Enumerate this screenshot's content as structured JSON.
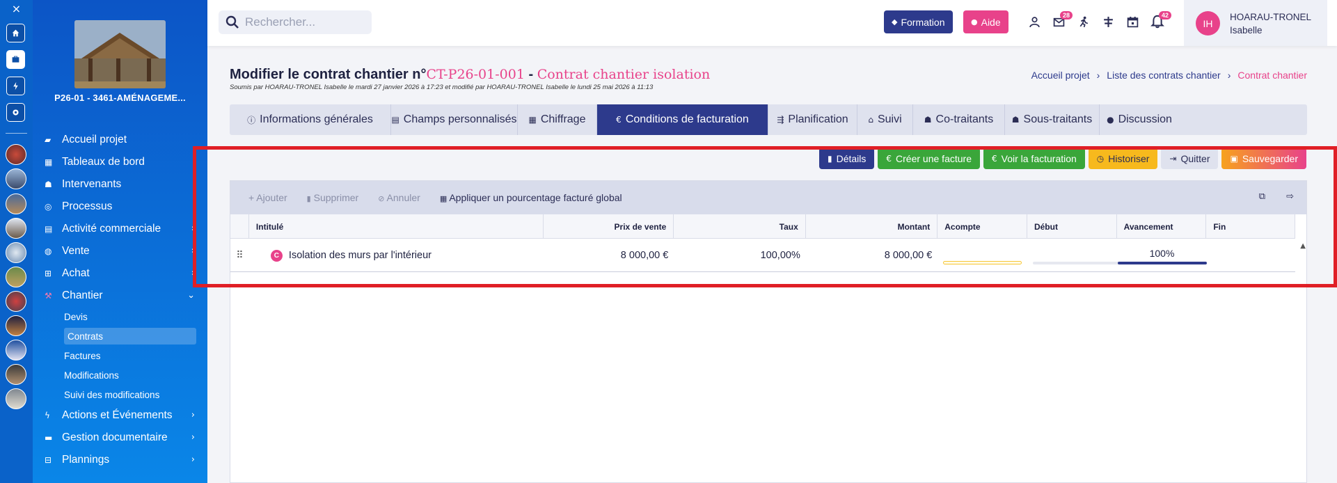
{
  "rail": {
    "close": "×"
  },
  "sidebar": {
    "project_title": "P26-01 - 3461-AMÉNAGEME...",
    "items": [
      {
        "label": "Accueil projet",
        "icon": "briefcase-icon",
        "chevron": false
      },
      {
        "label": "Tableaux de bord",
        "icon": "dashboard-icon",
        "chevron": false
      },
      {
        "label": "Intervenants",
        "icon": "people-icon",
        "chevron": false
      },
      {
        "label": "Processus",
        "icon": "process-icon",
        "chevron": false
      },
      {
        "label": "Activité commerciale",
        "icon": "document-icon",
        "chevron": true
      },
      {
        "label": "Vente",
        "icon": "sale-icon",
        "chevron": true
      },
      {
        "label": "Achat",
        "icon": "cart-icon",
        "chevron": true
      },
      {
        "label": "Chantier",
        "icon": "crane-icon",
        "chevron": true,
        "expanded": true
      }
    ],
    "subitems": [
      "Devis",
      "Contrats",
      "Factures",
      "Modifications",
      "Suivi des modifications"
    ],
    "items_after": [
      {
        "label": "Actions et Événements",
        "icon": "bolt-icon"
      },
      {
        "label": "Gestion documentaire",
        "icon": "folder-icon"
      },
      {
        "label": "Plannings",
        "icon": "calendar-icon"
      }
    ]
  },
  "topbar": {
    "search_placeholder": "Rechercher...",
    "formation": "Formation",
    "aide": "Aide",
    "mail_badge": "28",
    "bell_badge": "42",
    "user_initials": "IH",
    "user_line1": "HOARAU-TRONEL",
    "user_line2": "Isabelle"
  },
  "header": {
    "prefix": "Modifier le contrat chantier n°",
    "number": "CT-P26-01-001",
    "separator": " - ",
    "name": "Contrat chantier isolation",
    "subtitle": "Soumis par HOARAU-TRONEL Isabelle le mardi 27 janvier 2026 à 17:23 et modifié par HOARAU-TRONEL Isabelle le lundi 25 mai 2026 à 11:13"
  },
  "breadcrumb": [
    "Accueil projet",
    "Liste des contrats chantier",
    "Contrat chantier"
  ],
  "tabs": [
    {
      "label": "Informations générales",
      "icon": "ⓘ",
      "width": 232
    },
    {
      "label": "Champs personnalisés",
      "icon": "▤",
      "width": 182
    },
    {
      "label": "Chiffrage",
      "icon": "▦",
      "width": 114
    },
    {
      "label": "Conditions de facturation",
      "icon": "€",
      "width": 246,
      "active": true
    },
    {
      "label": "Planification",
      "icon": "⇶",
      "width": 128
    },
    {
      "label": "Suivi",
      "icon": "⌂",
      "width": 80
    },
    {
      "label": "Co-traitants",
      "icon": "☗",
      "width": 132
    },
    {
      "label": "Sous-traitants",
      "icon": "☗",
      "width": 136
    },
    {
      "label": "Discussion",
      "icon": "●",
      "width": 114
    }
  ],
  "actions": [
    {
      "label": "Détails",
      "icon": "▮",
      "style": "navy"
    },
    {
      "label": "Créer une facture",
      "icon": "€",
      "style": "green"
    },
    {
      "label": "Voir la facturation",
      "icon": "€",
      "style": "green"
    },
    {
      "label": "Historiser",
      "icon": "◷",
      "style": "yellow"
    },
    {
      "label": "Quitter",
      "icon": "⇥",
      "style": "grey"
    },
    {
      "label": "Sauvegarder",
      "icon": "▣",
      "style": "orange"
    }
  ],
  "toolbar": {
    "add": "Ajouter",
    "delete": "Supprimer",
    "cancel": "Annuler",
    "apply": "Appliquer un pourcentage facturé global"
  },
  "grid": {
    "columns": [
      "Intitulé",
      "Prix de vente",
      "Taux",
      "Montant",
      "Acompte",
      "Début",
      "Avancement",
      "Fin"
    ],
    "rows": [
      {
        "badge": "C",
        "label": "Isolation des murs par l'intérieur",
        "prix": "8 000,00 €",
        "taux": "100,00%",
        "montant": "8 000,00 €",
        "avancement": "100%",
        "avancement_value": 1.0
      }
    ]
  },
  "colors": {
    "navy": "#2d3a8c",
    "pink": "#e8428a",
    "green": "#3aa63a",
    "yellow": "#f7b91d",
    "highlight": "#e01f26"
  }
}
